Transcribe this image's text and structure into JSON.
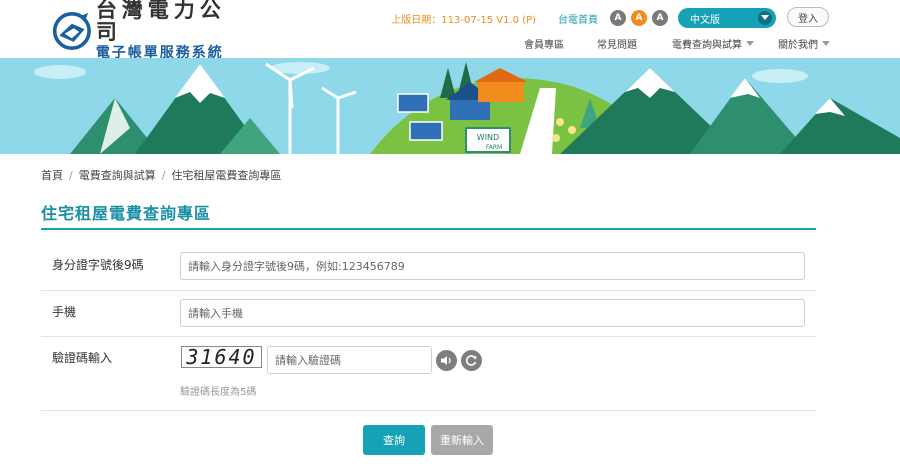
{
  "header": {
    "logo_title": "台灣電力公司",
    "logo_subtitle": "電子帳單服務系統",
    "update_text": "上版日期：113-07-15 V1.0 (P)",
    "home_link": "台電首頁",
    "font_sizes": [
      "A",
      "A",
      "A"
    ],
    "language": "中文版",
    "login": "登入",
    "nav": [
      {
        "label": "會員專區",
        "has_dropdown": false
      },
      {
        "label": "常見問題",
        "has_dropdown": false
      },
      {
        "label": "電費查詢與試算",
        "has_dropdown": true
      },
      {
        "label": "關於我們",
        "has_dropdown": true
      }
    ]
  },
  "banner": {
    "sign_line1": "WIND",
    "sign_line2": "FARM"
  },
  "breadcrumb": [
    "首頁",
    "電費查詢與試算",
    "住宅租屋電費查詢專區"
  ],
  "page_title": "住宅租屋電費查詢專區",
  "form": {
    "id_label": "身分證字號後9碼",
    "id_placeholder": "請輸入身分證字號後9碼，例如:123456789",
    "phone_label": "手機",
    "phone_placeholder": "請輸入手機",
    "captcha_label": "驗證碼輸入",
    "captcha_code": "31640",
    "captcha_placeholder": "請輸入驗證碼",
    "captcha_hint": "驗證碼長度為5碼"
  },
  "buttons": {
    "query": "查詢",
    "reset": "重新輸入"
  },
  "colors": {
    "accent": "#17a1b6",
    "orange": "#f08c1e",
    "brand_blue": "#1a5fa0"
  }
}
